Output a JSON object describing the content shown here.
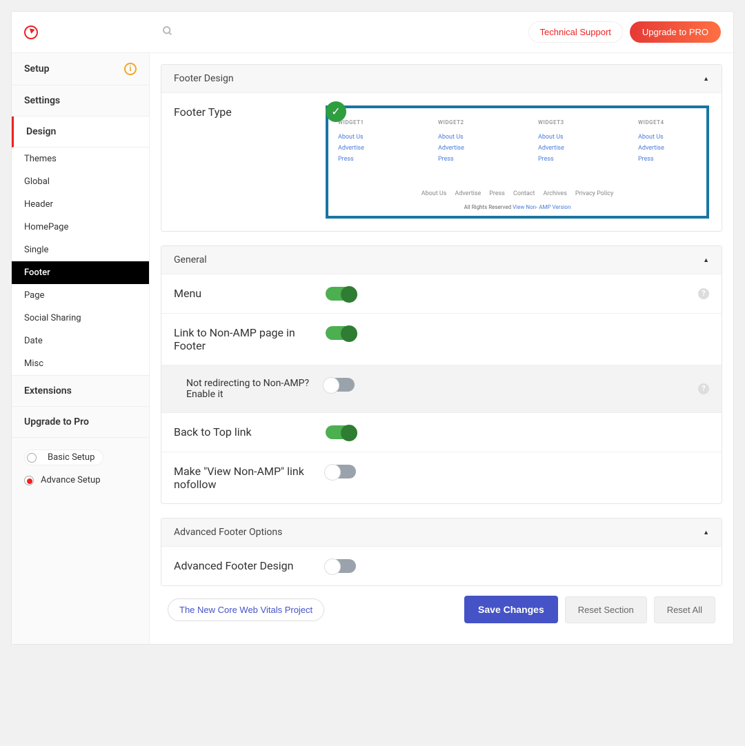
{
  "topbar": {
    "support": "Technical Support",
    "upgrade": "Upgrade to PRO"
  },
  "sidebar": {
    "setup": "Setup",
    "settings": "Settings",
    "design": "Design",
    "subitems": [
      "Themes",
      "Global",
      "Header",
      "HomePage",
      "Single",
      "Footer",
      "Page",
      "Social Sharing",
      "Date",
      "Misc"
    ],
    "active_sub": "Footer",
    "extensions": "Extensions",
    "upgrade": "Upgrade to Pro",
    "basic": "Basic Setup",
    "advance": "Advance Setup"
  },
  "footer_design": {
    "title": "Footer Design",
    "type_label": "Footer Type",
    "widgets": [
      "WIDGET1",
      "WIDGET2",
      "WIDGET3",
      "WIDGET4"
    ],
    "widget_links": [
      "About Us",
      "Advertise",
      "Press"
    ],
    "bottom_links": [
      "About Us",
      "Advertise",
      "Press",
      "Contact",
      "Archives",
      "Privacy Policy"
    ],
    "credit_prefix": "All Rights Reserved ",
    "credit_link": "View Non- AMP Version"
  },
  "general": {
    "title": "General",
    "menu": "Menu",
    "nonamp": "Link to Non-AMP page in Footer",
    "redirect": "Not redirecting to Non-AMP? Enable it",
    "backtotop": "Back to Top link",
    "nofollow": "Make \"View Non-AMP\" link nofollow"
  },
  "advanced": {
    "title": "Advanced Footer Options",
    "design": "Advanced Footer Design"
  },
  "bottombar": {
    "vitals": "The New Core Web Vitals Project",
    "save": "Save Changes",
    "reset_section": "Reset Section",
    "reset_all": "Reset All"
  }
}
